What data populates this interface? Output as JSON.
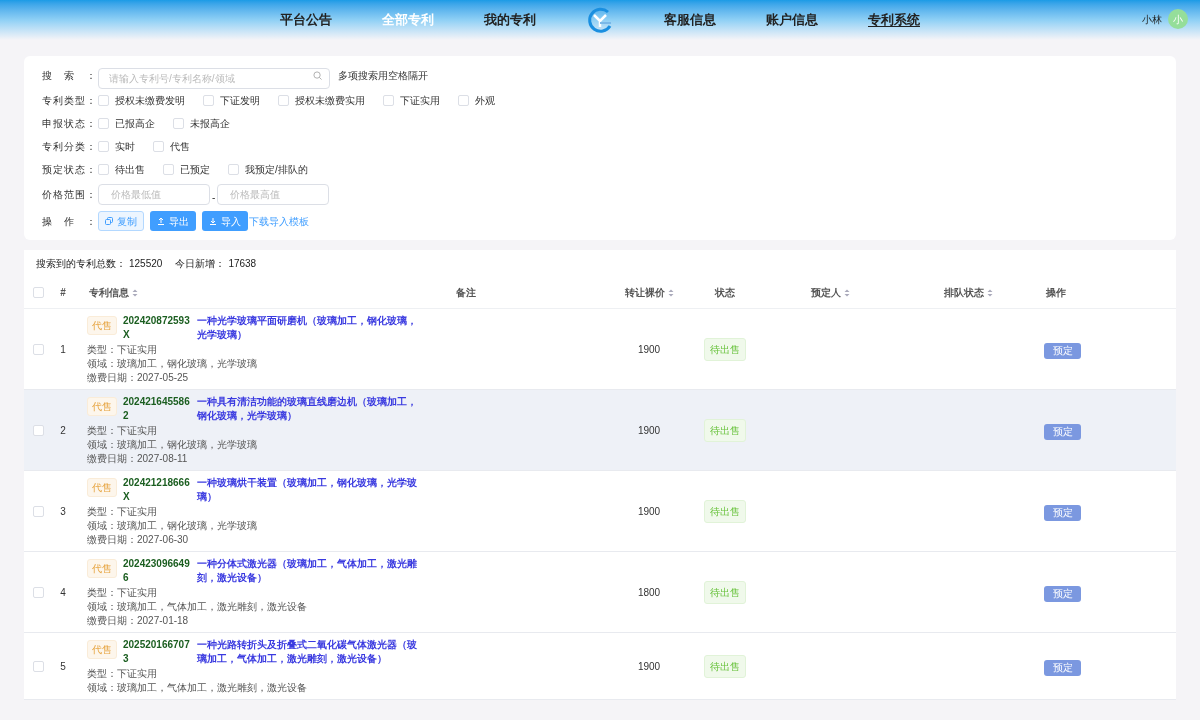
{
  "nav": {
    "items": [
      {
        "label": "平台公告",
        "active": false,
        "selected": false
      },
      {
        "label": "全部专利",
        "active": true,
        "selected": false
      },
      {
        "label": "我的专利",
        "active": false,
        "selected": false
      },
      {
        "kind": "logo"
      },
      {
        "label": "客服信息",
        "active": false,
        "selected": false
      },
      {
        "label": "账户信息",
        "active": false,
        "selected": false
      },
      {
        "label": "专利系统",
        "active": false,
        "selected": true
      }
    ],
    "user": {
      "name": "小林",
      "avatar": "小"
    }
  },
  "filters": {
    "search": {
      "label": "搜索：",
      "placeholder": "请输入专利号/专利名称/领域",
      "hint": "多项搜索用空格隔开"
    },
    "groups": [
      {
        "label": "专利类型：",
        "options": [
          {
            "label": "授权未缴费发明",
            "checked": false
          },
          {
            "label": "下证发明",
            "checked": false
          },
          {
            "label": "授权未缴费实用",
            "checked": false
          },
          {
            "label": "下证实用",
            "checked": false
          },
          {
            "label": "外观",
            "checked": false
          }
        ]
      },
      {
        "label": "申报状态：",
        "options": [
          {
            "label": "已报高企",
            "checked": false
          },
          {
            "label": "未报高企",
            "checked": false
          }
        ]
      },
      {
        "label": "专利分类：",
        "options": [
          {
            "label": "实时",
            "checked": false
          },
          {
            "label": "代售",
            "checked": false
          }
        ]
      },
      {
        "label": "预定状态：",
        "options": [
          {
            "label": "待出售",
            "checked": false
          },
          {
            "label": "已预定",
            "checked": false
          },
          {
            "label": "我预定/排队的",
            "checked": false
          }
        ]
      }
    ],
    "price": {
      "label": "价格范围：",
      "min_placeholder": "价格最低值",
      "separator": "-",
      "max_placeholder": "价格最高值"
    },
    "actions": {
      "label": "操作：",
      "buttons": [
        {
          "kind": "copy",
          "label": "复制"
        },
        {
          "kind": "export",
          "label": "导出"
        },
        {
          "kind": "import",
          "label": "导入"
        }
      ],
      "link": "下载导入模板"
    }
  },
  "stats": [
    {
      "label": "搜索到的专利总数：",
      "value": "125520"
    },
    {
      "label": "今日新增：",
      "value": "17638"
    }
  ],
  "table": {
    "header_checked": false,
    "columns": [
      {
        "label": "#",
        "sortable": false
      },
      {
        "label": "专利信息",
        "sortable": true
      },
      {
        "label": "备注",
        "sortable": false
      },
      {
        "label": "转让裸价",
        "sortable": true
      },
      {
        "label": "状态",
        "sortable": false
      },
      {
        "label": "预定人",
        "sortable": true
      },
      {
        "label": "排队状态",
        "sortable": true
      },
      {
        "label": "操作",
        "sortable": false
      }
    ],
    "rows": [
      {
        "checked": false,
        "highlighted": false,
        "index": "1",
        "tag": "代售",
        "number": "202420872593X",
        "title": "一种光学玻璃平面研磨机（玻璃加工，钢化玻璃，光学玻璃）",
        "type": "类型：下证实用",
        "field": "领域：玻璃加工，钢化玻璃，光学玻璃",
        "date": "缴费日期：2027-05-25",
        "price": "1900",
        "status": "待出售",
        "action": "预定"
      },
      {
        "checked": false,
        "highlighted": true,
        "index": "2",
        "tag": "代售",
        "number": "2024216455862",
        "title": "一种具有清洁功能的玻璃直线磨边机（玻璃加工，钢化玻璃，光学玻璃）",
        "type": "类型：下证实用",
        "field": "领域：玻璃加工，钢化玻璃，光学玻璃",
        "date": "缴费日期：2027-08-11",
        "price": "1900",
        "status": "待出售",
        "action": "预定"
      },
      {
        "checked": false,
        "highlighted": false,
        "index": "3",
        "tag": "代售",
        "number": "202421218666X",
        "title": "一种玻璃烘干装置（玻璃加工，钢化玻璃，光学玻璃）",
        "type": "类型：下证实用",
        "field": "领域：玻璃加工，钢化玻璃，光学玻璃",
        "date": "缴费日期：2027-06-30",
        "price": "1900",
        "status": "待出售",
        "action": "预定"
      },
      {
        "checked": false,
        "highlighted": false,
        "index": "4",
        "tag": "代售",
        "number": "2024230966496",
        "title": "一种分体式激光器（玻璃加工，气体加工，激光雕刻，激光设备）",
        "type": "类型：下证实用",
        "field": "领域：玻璃加工，气体加工，激光雕刻，激光设备",
        "date": "缴费日期：2027-01-18",
        "price": "1800",
        "status": "待出售",
        "action": "预定"
      },
      {
        "checked": false,
        "highlighted": false,
        "index": "5",
        "tag": "代售",
        "number": "2025201667073",
        "title": "一种光路转折头及折叠式二氧化碳气体激光器（玻璃加工，气体加工，激光雕刻，激光设备）",
        "type": "类型：下证实用",
        "field": "领域：玻璃加工，气体加工，激光雕刻，激光设备",
        "price": "1900",
        "status": "待出售",
        "action": "预定"
      }
    ]
  }
}
